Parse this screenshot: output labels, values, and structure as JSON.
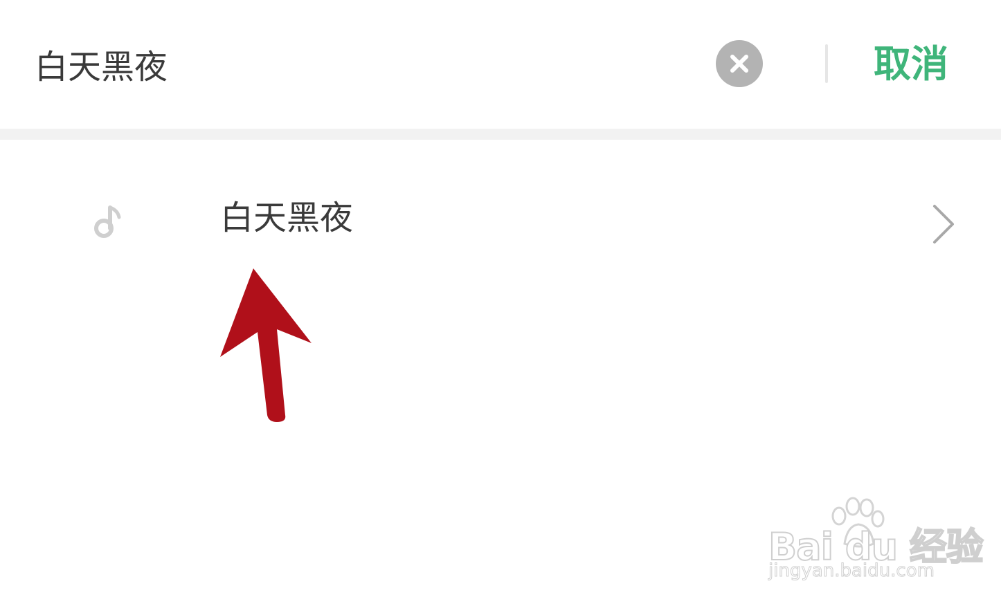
{
  "search": {
    "value": "白天黑夜",
    "cancel_label": "取消"
  },
  "suggestions": [
    {
      "label": "白天黑夜",
      "icon": "music-note-icon"
    }
  ],
  "watermark": {
    "brand": "Bai du 经验",
    "url": "jingyan.baidu.com"
  },
  "colors": {
    "accent": "#3fb57a",
    "clear_button": "#b3b3b3",
    "annotation_arrow": "#b0101a"
  }
}
